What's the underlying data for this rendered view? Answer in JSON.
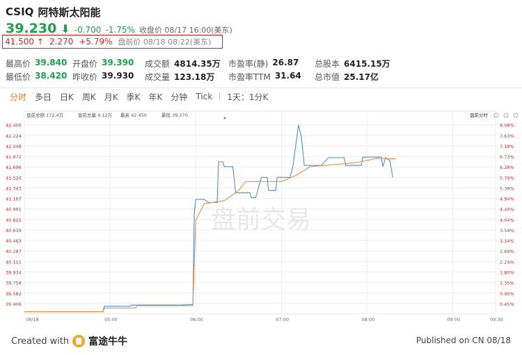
{
  "stock": {
    "code": "CSIQ",
    "name": "阿特斯太阳能",
    "price": "39.230",
    "arrow": "⬇",
    "change": "-0.700",
    "change_pct": "-1.75%",
    "close_label": "收盘价 08/17 16:00(美东)"
  },
  "premarket": {
    "price": "41.500",
    "arrow": "↑",
    "change": "2.270",
    "change_pct": "+5.79%",
    "time_label": "盘前价 08/18 08:22(美东)"
  },
  "stats": {
    "row1": [
      {
        "label": "最高价",
        "value": "39.840",
        "color": "green"
      },
      {
        "label": "开盘价",
        "value": "39.390",
        "color": "green"
      },
      {
        "label": "成交额",
        "value": "4814.35万",
        "color": "normal"
      },
      {
        "label": "市盈率(静)",
        "value": "26.87",
        "color": "normal"
      },
      {
        "label": "总股本",
        "value": "6415.15万",
        "color": "normal"
      }
    ],
    "row2": [
      {
        "label": "最低价",
        "value": "38.420",
        "color": "green"
      },
      {
        "label": "昨收价",
        "value": "39.930",
        "color": "normal"
      },
      {
        "label": "成交量",
        "value": "123.18万",
        "color": "normal"
      },
      {
        "label": "市盈率TTM",
        "value": "31.64",
        "color": "normal"
      },
      {
        "label": "总市值",
        "value": "25.17亿",
        "color": "normal"
      }
    ]
  },
  "tabs": [
    "分时",
    "多日",
    "日K",
    "周K",
    "月K",
    "季K",
    "年K",
    "分钟",
    "Tick"
  ],
  "tab_extra": "1天：1分K",
  "chart_header": {
    "total": "盘前总额 172.4万",
    "volume": "盘前总量 4.12万",
    "high": "最高 42.450",
    "low": "最低 39.370",
    "right_label": "盘前分时"
  },
  "watermark": "盘前交易",
  "chart_data": {
    "type": "line",
    "y_ticks": [
      "42.400",
      "42.224",
      "42.048",
      "41.872",
      "41.696",
      "41.520",
      "41.343",
      "41.167",
      "40.991",
      "40.815",
      "40.639",
      "40.463",
      "40.287",
      "40.111",
      "39.934",
      "39.758",
      "39.582",
      "39.406"
    ],
    "pct_ticks": [
      "8.08%",
      "7.63%",
      "7.18%",
      "6.73%",
      "6.28%",
      "5.79%",
      "5.38%",
      "4.94%",
      "4.49%",
      "4.04%",
      "3.59%",
      "3.14%",
      "2.69%",
      "2.24%",
      "1.80%",
      "1.35%",
      "0.90%",
      "0.45%"
    ],
    "reference_line": "41.500",
    "x_ticks": [
      "08/18",
      "05:00",
      "06:00",
      "07:00",
      "08:00",
      "09:00",
      "09:30"
    ],
    "x_minutes": [
      0,
      60,
      120,
      180,
      240,
      300,
      330
    ],
    "ylim": [
      39.23,
      42.49
    ],
    "series": [
      {
        "color": "#4a90d9",
        "points": [
          [
            0,
            39.27
          ],
          [
            55,
            39.27
          ],
          [
            56,
            39.36
          ],
          [
            74,
            39.36
          ],
          [
            75,
            39.38
          ],
          [
            110,
            39.38
          ],
          [
            118,
            39.39
          ],
          [
            119,
            40.9
          ],
          [
            120,
            41.15
          ],
          [
            126,
            41.15
          ],
          [
            129,
            41.1
          ],
          [
            135,
            41.1
          ],
          [
            136,
            41.78
          ],
          [
            139,
            41.78
          ],
          [
            140,
            41.7
          ],
          [
            146,
            41.7
          ],
          [
            148,
            41.26
          ],
          [
            158,
            41.26
          ],
          [
            159,
            41.18
          ],
          [
            162,
            41.18
          ],
          [
            164,
            41.35
          ],
          [
            166,
            41.52
          ],
          [
            170,
            41.52
          ],
          [
            171,
            41.3
          ],
          [
            176,
            41.3
          ],
          [
            177,
            41.52
          ],
          [
            182,
            41.52
          ],
          [
            186,
            41.52
          ],
          [
            188,
            41.7
          ],
          [
            192,
            42.4
          ],
          [
            194,
            42.2
          ],
          [
            196,
            41.72
          ],
          [
            208,
            41.72
          ],
          [
            213,
            41.85
          ],
          [
            224,
            41.85
          ],
          [
            225,
            41.72
          ],
          [
            236,
            41.72
          ],
          [
            237,
            41.86
          ],
          [
            250,
            41.86
          ],
          [
            251,
            41.7
          ],
          [
            253,
            41.85
          ],
          [
            256,
            41.8
          ],
          [
            258,
            41.52
          ]
        ]
      },
      {
        "color": "#e8913a",
        "points": [
          [
            0,
            39.27
          ],
          [
            55,
            39.27
          ],
          [
            56,
            39.33
          ],
          [
            78,
            39.33
          ],
          [
            79,
            39.37
          ],
          [
            118,
            39.37
          ],
          [
            120,
            40.8
          ],
          [
            126,
            41.08
          ],
          [
            140,
            41.13
          ],
          [
            150,
            41.3
          ],
          [
            155,
            41.45
          ],
          [
            180,
            41.45
          ],
          [
            190,
            41.55
          ],
          [
            200,
            41.7
          ],
          [
            210,
            41.72
          ],
          [
            225,
            41.75
          ],
          [
            235,
            41.78
          ],
          [
            247,
            41.84
          ],
          [
            260,
            41.83
          ]
        ]
      }
    ]
  },
  "footer": {
    "created_with": "Created with",
    "logo_text": "富途牛牛",
    "published": "Published on CN 08/18"
  },
  "colors": {
    "up": "#e02020",
    "down": "#1aa34a",
    "accent": "#e67e22",
    "ref_line": "#f59a6a",
    "grid": "#eeeeee"
  }
}
